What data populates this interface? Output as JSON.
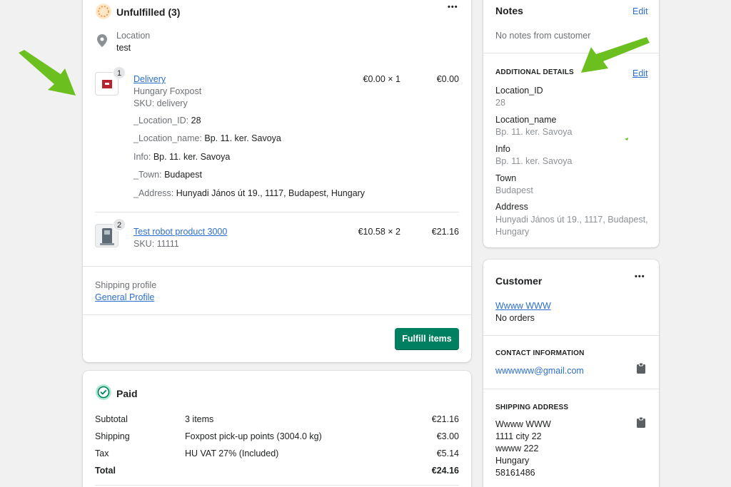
{
  "unfulfilled": {
    "title": "Unfulfilled (3)",
    "more": "•••",
    "location_label": "Location",
    "location_value": "test",
    "items": [
      {
        "qty_badge": "1",
        "name": "Delivery",
        "vendor": "Hungary Foxpost",
        "sku": "SKU: delivery",
        "unit_price": "€0.00 × 1",
        "total": "€0.00",
        "properties": [
          {
            "key": "_Location_ID:",
            "value": "28"
          },
          {
            "key": "_Location_name:",
            "value": "Bp. 11. ker. Savoya"
          },
          {
            "key": "Info:",
            "value": "Bp. 11. ker. Savoya"
          },
          {
            "key": "_Town:",
            "value": "Budapest"
          },
          {
            "key": "_Address:",
            "value": "Hunyadi János út 19., 1117, Budapest, Hungary"
          }
        ]
      },
      {
        "qty_badge": "2",
        "name": "Test robot product 3000",
        "sku": "SKU: 11111",
        "unit_price": "€10.58 × 2",
        "total": "€21.16"
      }
    ],
    "shipping_profile_label": "Shipping profile",
    "shipping_profile_link": "General Profile",
    "fulfill_button": "Fulfill items"
  },
  "paid": {
    "title": "Paid",
    "rows": [
      {
        "label": "Subtotal",
        "desc": "3 items",
        "amount": "€21.16"
      },
      {
        "label": "Shipping",
        "desc": "Foxpost pick-up points (3004.0 kg)",
        "amount": "€3.00"
      },
      {
        "label": "Tax",
        "desc": "HU VAT 27% (Included)",
        "amount": "€5.14"
      },
      {
        "label": "Total",
        "desc": "",
        "amount": "€24.16"
      }
    ]
  },
  "notes": {
    "title": "Notes",
    "edit": "Edit",
    "empty": "No notes from customer",
    "additional_title": "ADDITIONAL DETAILS",
    "additional_edit": "Edit",
    "details": [
      {
        "key": "Location_ID",
        "value": "28"
      },
      {
        "key": "Location_name",
        "value": "Bp. 11. ker. Savoya"
      },
      {
        "key": "Info",
        "value": "Bp. 11. ker. Savoya"
      },
      {
        "key": "Town",
        "value": "Budapest"
      },
      {
        "key": "Address",
        "value": "Hunyadi János út 19., 1117, Budapest, Hungary"
      }
    ]
  },
  "customer": {
    "title": "Customer",
    "more": "•••",
    "name": "Wwww WWW",
    "orders": "No orders",
    "contact_title": "CONTACT INFORMATION",
    "email": "wwwwww@gmail.com",
    "shipping_title": "SHIPPING ADDRESS",
    "address_lines": [
      "Wwww WWW",
      "1111 city 22",
      "wwww 222",
      "Hungary",
      "58161486"
    ]
  },
  "colors": {
    "accent": "#008060",
    "link": "#2c6ecb",
    "arrow": "#6bbf1f",
    "unfulfilled_ring": "#f1a04d"
  }
}
